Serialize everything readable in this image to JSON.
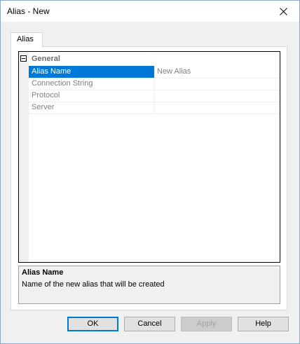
{
  "window": {
    "title": "Alias - New"
  },
  "tabs": [
    {
      "label": "Alias"
    }
  ],
  "property_grid": {
    "category": "General",
    "rows": [
      {
        "name": "Alias Name",
        "value": "New Alias",
        "selected": true
      },
      {
        "name": "Connection String",
        "value": ""
      },
      {
        "name": "Protocol",
        "value": ""
      },
      {
        "name": "Server",
        "value": ""
      }
    ]
  },
  "help_pane": {
    "title": "Alias Name",
    "description": "Name of the new alias that will be created"
  },
  "buttons": {
    "ok": "OK",
    "cancel": "Cancel",
    "apply": "Apply",
    "help": "Help"
  },
  "colors": {
    "selection": "#0078d7",
    "dialog_bg": "#f0f0f0"
  },
  "icons": {
    "close": "close-icon",
    "collapse": "collapse-minus-icon"
  }
}
